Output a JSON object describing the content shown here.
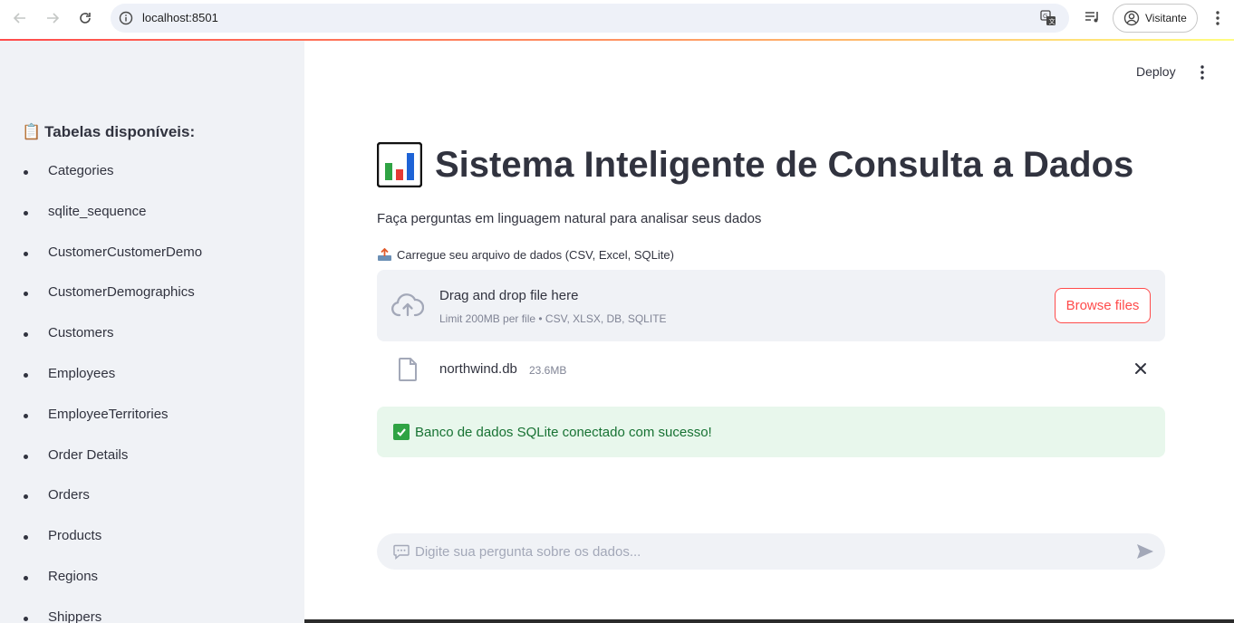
{
  "browser": {
    "url": "localhost:8501",
    "profile_label": "Visitante"
  },
  "sidebar": {
    "title_emoji": "📋",
    "title": "Tabelas disponíveis:",
    "tables": [
      "Categories",
      "sqlite_sequence",
      "CustomerCustomerDemo",
      "CustomerDemographics",
      "Customers",
      "Employees",
      "EmployeeTerritories",
      "Order Details",
      "Orders",
      "Products",
      "Regions",
      "Shippers"
    ]
  },
  "header": {
    "deploy_label": "Deploy"
  },
  "main": {
    "title": "Sistema Inteligente de Consulta a Dados",
    "subtitle": "Faça perguntas em linguagem natural para analisar seus dados",
    "uploader": {
      "label": "Carregue seu arquivo de dados (CSV, Excel, SQLite)",
      "drop_title": "Drag and drop file here",
      "limit_text": "Limit 200MB per file • CSV, XLSX, DB, SQLITE",
      "browse_label": "Browse files"
    },
    "uploaded_file": {
      "name": "northwind.db",
      "size": "23.6MB"
    },
    "success_message": "Banco de dados SQLite conectado com sucesso!",
    "chat_input": {
      "placeholder": "Digite sua pergunta sobre os dados..."
    }
  },
  "colors": {
    "accent": "#ff4b4b",
    "sidebar_bg": "#f0f2f6",
    "success_bg": "#e8f7ec",
    "success_text": "#177233"
  }
}
